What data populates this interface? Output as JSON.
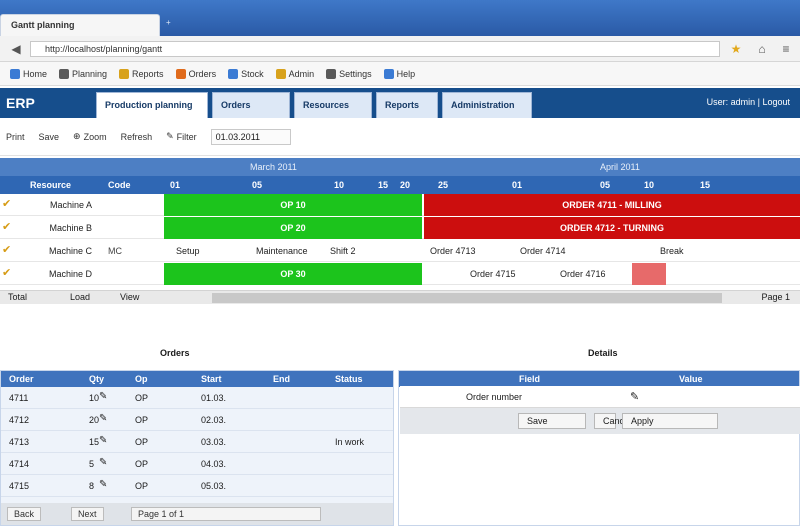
{
  "browser": {
    "tab_title": "Gantt planning",
    "new_tab": "+",
    "url": "http://localhost/planning/gantt",
    "bookmarks": [
      {
        "label": "Home",
        "color": "#3b7bd4"
      },
      {
        "label": "Planning",
        "color": "#5a5a5a"
      },
      {
        "label": "Reports",
        "color": "#d8a21c"
      },
      {
        "label": "Orders",
        "color": "#e06b1c"
      },
      {
        "label": "Stock",
        "color": "#3b7bd4"
      },
      {
        "label": "Admin",
        "color": "#d8a21c"
      },
      {
        "label": "Settings",
        "color": "#5a5a5a"
      },
      {
        "label": "Help",
        "color": "#3b7bd4"
      }
    ]
  },
  "app": {
    "logo": "ERP",
    "tabs": [
      "Production planning",
      "Orders",
      "Resources",
      "Reports",
      "Administration"
    ],
    "user": "User: admin | Logout"
  },
  "toolbar": {
    "items": [
      "Print",
      "Save",
      "Zoom",
      "Refresh",
      "Filter"
    ],
    "date_field": "01.03.2011"
  },
  "gantt": {
    "header1": {
      "left": "March 2011",
      "right": "April 2011"
    },
    "header2": [
      "Resource",
      "Code",
      "01",
      "05",
      "10",
      "15",
      "20",
      "25",
      "01",
      "05",
      "10",
      "15"
    ],
    "rows": [
      {
        "name": "Machine A",
        "code": "",
        "bars": [
          {
            "type": "green",
            "label": "OP 10"
          },
          {
            "type": "red",
            "label": "ORDER 4711 - MILLING"
          }
        ]
      },
      {
        "name": "Machine B",
        "code": "",
        "bars": [
          {
            "type": "green",
            "label": "OP 20"
          },
          {
            "type": "red",
            "label": "ORDER 4712 - TURNING"
          }
        ]
      },
      {
        "name": "Machine C",
        "code": "MC",
        "texts": [
          "Setup",
          "Maintenance",
          "Shift 2",
          "Order 4713",
          "Order 4714",
          "Break"
        ]
      },
      {
        "name": "Machine D",
        "code": "",
        "bars": [
          {
            "type": "green",
            "label": "OP 30"
          }
        ],
        "texts": [
          "Order 4715",
          "Order 4716"
        ]
      }
    ],
    "scroll_labels": [
      "Total",
      "Load",
      "View"
    ],
    "scroll_right": "Page 1"
  },
  "bottom": {
    "left_title": "Orders",
    "right_title": "Details",
    "left_headers": [
      "Order",
      "Qty",
      "Op",
      "Start",
      "End",
      "Status"
    ],
    "left_rows": [
      [
        "4711",
        "10",
        "OP",
        "01.03.",
        "",
        ""
      ],
      [
        "4712",
        "20",
        "OP",
        "02.03.",
        "",
        ""
      ],
      [
        "4713",
        "15",
        "OP",
        "03.03.",
        "",
        "In work"
      ],
      [
        "4714",
        "5",
        "OP",
        "04.03.",
        "",
        ""
      ],
      [
        "4715",
        "8",
        "OP",
        "05.03.",
        "",
        ""
      ]
    ],
    "left_footer": [
      "Back",
      "Next",
      "Page 1 of 1"
    ],
    "right_headers": [
      "Field",
      "Value"
    ],
    "right_field": "Order number",
    "right_buttons": [
      "Save",
      "Cancel",
      "Apply"
    ]
  }
}
